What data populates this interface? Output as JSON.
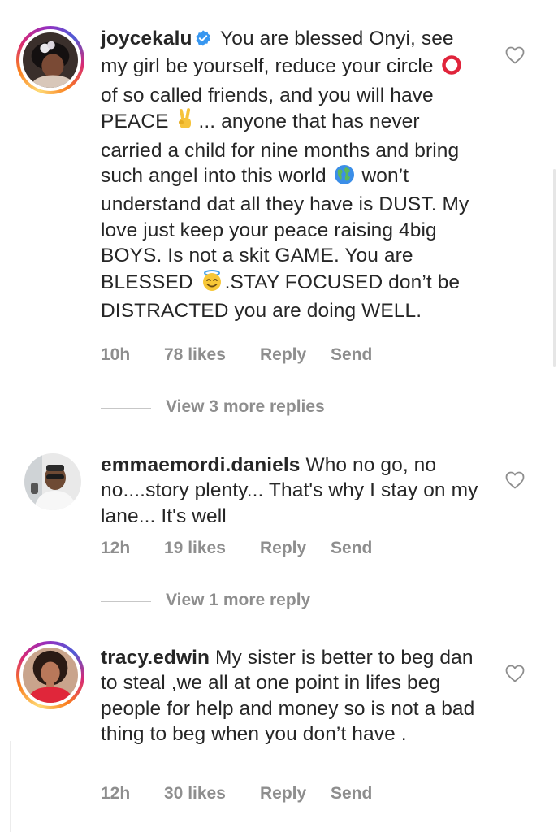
{
  "comments": [
    {
      "username": "joycekalu",
      "verified": true,
      "text_parts": [
        "You are blessed Onyi, see my girl be yourself, reduce your circle ",
        " of so called friends, and you will have PEACE ",
        "... anyone that has never carried a child for nine months and bring such angel into this world ",
        " won’t understand dat all they have is DUST. My love just keep your peace raising 4big BOYS. Is not a skit GAME. You are BLESSED ",
        ".STAY FOCUSED don’t be DISTRACTED you are doing WELL."
      ],
      "emojis": [
        "hollow-red-circle-emoji",
        "victory-hand-emoji",
        "globe-emoji",
        "smiling-face-with-halo-emoji"
      ],
      "time": "10h",
      "likes": "78 likes",
      "reply": "Reply",
      "send": "Send",
      "view_replies": "View 3 more replies"
    },
    {
      "username": "emmaemordi.daniels",
      "verified": false,
      "text": "Who no go, no no....story plenty... That's why I stay on my lane... It's well",
      "time": "12h",
      "likes": "19 likes",
      "reply": "Reply",
      "send": "Send",
      "view_replies": "View 1 more reply"
    },
    {
      "username": "tracy.edwin",
      "verified": false,
      "text": "My sister is better to beg dan to steal ,we all at one point in lifes beg people for help and money so is not a bad thing to beg when you don’t have .",
      "time": "12h",
      "likes": "30 likes",
      "reply": "Reply",
      "send": "Send"
    }
  ],
  "colors": {
    "text": "#262626",
    "meta": "#8e8e8e",
    "verified": "#3897f0",
    "story_ring": [
      "#feda75",
      "#fa7e1e",
      "#d62976",
      "#962fbf",
      "#4f5bd5"
    ]
  },
  "icons": {
    "like": "heart-outline-icon",
    "verified": "verified-badge-icon"
  }
}
